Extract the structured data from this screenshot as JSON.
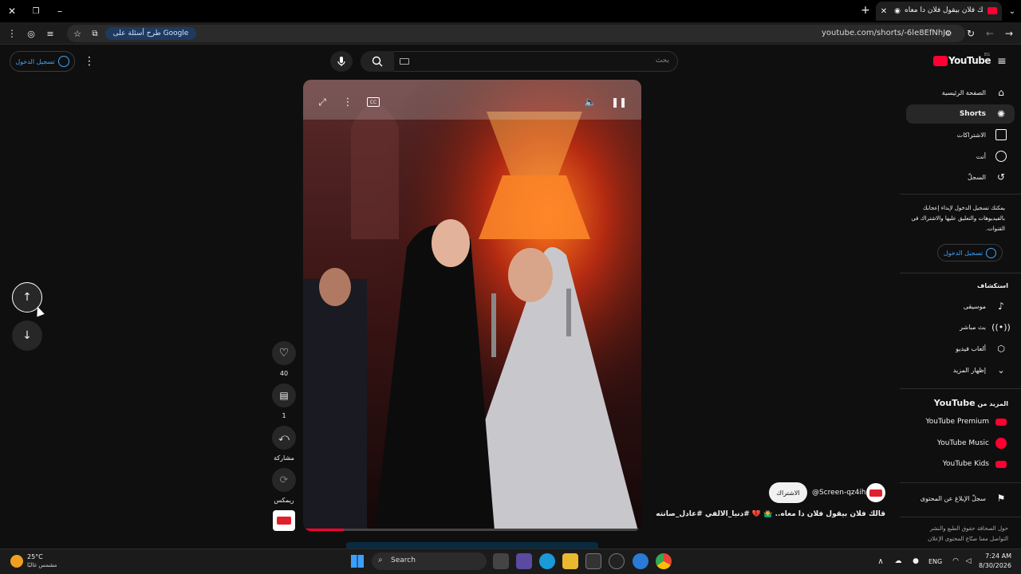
{
  "browser": {
    "tab_title": "قالك فلان بيقول فلان دا معاه..",
    "url": "youtube.com/shorts/-6le8EfNhJc",
    "google_chip": "طرح أسئلة على Google"
  },
  "youtube": {
    "logo_text": "YouTube",
    "logo_region": "EG",
    "search_placeholder": "بحث",
    "signin_label": "تسجيل الدخول"
  },
  "sidebar": {
    "items": [
      {
        "label": "الصفحة الرئيسية",
        "icon": "home-icon"
      },
      {
        "label": "Shorts",
        "icon": "shorts-icon",
        "active": true
      },
      {
        "label": "الاشتراكات",
        "icon": "subscriptions-icon"
      },
      {
        "label": "أنت",
        "icon": "user-icon"
      },
      {
        "label": "السجلّ",
        "icon": "history-icon"
      }
    ],
    "signin_prompt": "يمكنك تسجيل الدخول لإبداء إعجابك بالفيديوهات والتعليق عليها والاشتراك في القنوات.",
    "signin_button": "تسجيل الدخول",
    "explore_title": "استكشاف",
    "explore": [
      {
        "label": "موسيقى",
        "icon": "music-icon"
      },
      {
        "label": "بث مباشر",
        "icon": "live-icon"
      },
      {
        "label": "ألعاب فيديو",
        "icon": "gaming-icon"
      },
      {
        "label": "إظهار المزيد",
        "icon": "chevron-down-icon"
      }
    ],
    "more_title_prefix": "المزيد من ",
    "more_title_brand": "YouTube",
    "more": [
      {
        "label": "YouTube Premium",
        "color": "#ff0033"
      },
      {
        "label": "YouTube Music",
        "color": "#ff0033"
      },
      {
        "label": "YouTube Kids",
        "color": "#ff0033"
      }
    ],
    "report_label": "سجلّ الإبلاغ عن المحتوى",
    "footer_line1": "حول  الصحافة  حقوق الطبع والنشر",
    "footer_line2": "التواصل معنا  صنّاع المحتوى  الإعلان"
  },
  "short": {
    "likes": "40",
    "comments": "1",
    "share_label": "مشاركة",
    "remix_label": "ريمكس",
    "channel": "@Screen-qz4ih",
    "subscribe": "الاشتراك",
    "title": "قالك فلان بيقول فلان دا معاه.. 🤷‍♂️ 💔 #دنيا_الالفي #عادل_صانته"
  },
  "taskbar": {
    "weather_temp": "25°C",
    "weather_desc": "مشمس غالبًا",
    "search_label": "Search",
    "lang": "ENG",
    "time": "7:24 AM",
    "date": "8/30/2026"
  }
}
